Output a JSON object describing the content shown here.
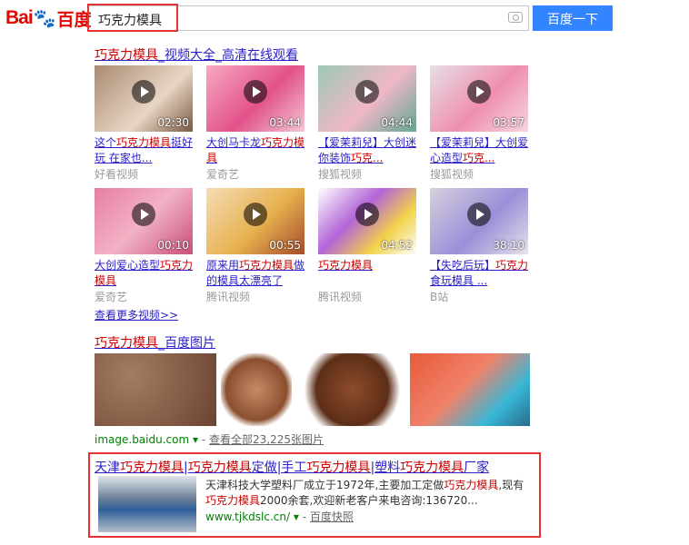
{
  "header": {
    "logo_text_bai": "Bai",
    "logo_text_du": "百度",
    "query": "巧克力模具",
    "search_button": "百度一下"
  },
  "video_section": {
    "title_em": "巧克力模具",
    "title_rest": "_视频大全_高清在线观看",
    "videos": [
      {
        "duration": "02:30",
        "title_pre": "这个",
        "title_em": "巧克力模具",
        "title_post": "挺好玩 在家也...",
        "source": "好看视频"
      },
      {
        "duration": "03:44",
        "title_pre": "大创马卡龙",
        "title_em": "巧克力模具",
        "title_post": "",
        "source": "爱奇艺"
      },
      {
        "duration": "04:44",
        "title_pre": "【爱茉莉兒】大创迷你装饰",
        "title_em": "巧克...",
        "title_post": "",
        "source": "搜狐视频"
      },
      {
        "duration": "03:57",
        "title_pre": "【爱茉莉兒】大创爱心造型",
        "title_em": "巧克...",
        "title_post": "",
        "source": "搜狐视频"
      },
      {
        "duration": "00:10",
        "title_pre": "大创爱心造型",
        "title_em": "巧克力模具",
        "title_post": "",
        "source": "爱奇艺"
      },
      {
        "duration": "00:55",
        "title_pre": "原来用",
        "title_em": "巧克力模具",
        "title_post": "做的模具太漂亮了",
        "source": "腾讯视频"
      },
      {
        "duration": "04:52",
        "title_pre": "",
        "title_em": "巧克力模具",
        "title_post": "",
        "source": "腾讯视频"
      },
      {
        "duration": "38:10",
        "title_pre": "【失吃后玩】",
        "title_em": "巧克力",
        "title_post": "食玩模具 ...",
        "source": "B站"
      }
    ],
    "more_link": "查看更多视频>>"
  },
  "image_section": {
    "title_em": "巧克力模具",
    "title_rest": "_百度图片",
    "domain": "image.baidu.com",
    "more_link": "查看全部23,225张图片"
  },
  "ad": {
    "title_parts": [
      "天津",
      "巧克力模具",
      "|",
      "巧克力模具",
      "定做|手工",
      "巧克力模具",
      "|塑料",
      "巧克力模具",
      "厂家"
    ],
    "desc_pre": "天津科技大学塑料厂成立于1972年,主要加工定做",
    "desc_em1": "巧克力模具",
    "desc_mid": ",现有",
    "desc_em2": "巧克力模具",
    "desc_post": "2000余套,欢迎新老客户来电咨询:136720...",
    "url": "www.tjkdslc.cn/",
    "snapshot": "百度快照"
  },
  "colors": {
    "link": "#2b20c8",
    "highlight": "#c00",
    "brand_blue": "#3385ff",
    "annotation": "#e53333"
  }
}
